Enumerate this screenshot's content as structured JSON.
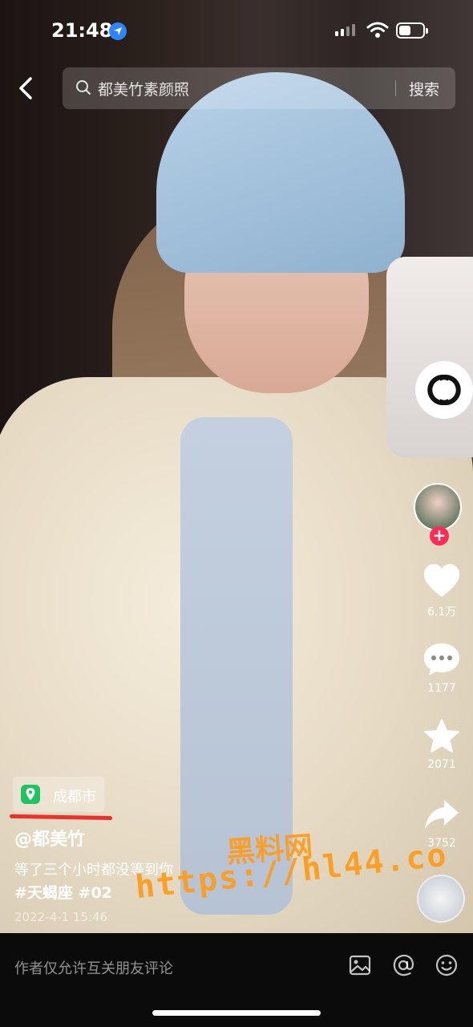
{
  "status_bar": {
    "time": "21:48"
  },
  "search": {
    "query": "都美竹素颜照",
    "button": "搜索"
  },
  "sidebar": {
    "likes": "6.1万",
    "comments": "1177",
    "favorites": "2071",
    "shares": "3752"
  },
  "post": {
    "location": "成都市",
    "author": "@都美竹",
    "description": "等了三个小时都没等到你",
    "tags": "#天蝎座 #02",
    "date": "2022-4-1 15:46"
  },
  "watermark": {
    "line1": "黑料网",
    "line2": "https://hl44.co"
  },
  "bottom_bar": {
    "comment_placeholder": "作者仅允许互关朋友评论"
  },
  "phone_case": {
    "brand_text": "CHANEL"
  },
  "icons": [
    "location-arrow-icon",
    "signal-icon",
    "wifi-icon",
    "battery-icon",
    "back-icon",
    "search-icon",
    "heart-icon",
    "comment-icon",
    "star-icon",
    "share-icon",
    "image-icon",
    "at-icon",
    "emoji-icon"
  ]
}
